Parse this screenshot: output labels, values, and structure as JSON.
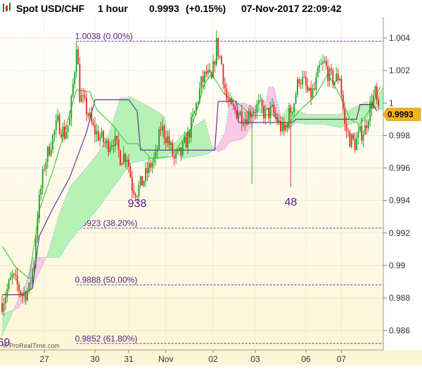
{
  "header": {
    "instrument": "Spot USD/CHF",
    "timeframe": "1 hour",
    "price": "0.9993",
    "change": "(+0.15%)",
    "datetime": "07-Nov-2017 22:09:42",
    "icon": "chart-logo-icon"
  },
  "watermark": "© ProRealTime.com",
  "colors": {
    "background_top": "#ffffff",
    "background_bottom": "#fcf6d6",
    "up_candle": "#1e9e1e",
    "down_candle": "#e8221a",
    "kumo_bull_fill": "#b6f2b6",
    "kumo_bear_fill": "#fbc8e8",
    "kijun": "#6a1a9a",
    "tenkan": "#33cc33",
    "fib_line": "#5a1a8a",
    "price_tag": "#f6b21a"
  },
  "chart_data": {
    "type": "candlestick",
    "title": "Spot USD/CHF",
    "timeframe": "1 hour",
    "x_tick_labels": [
      "27",
      "30",
      "31",
      "Nov",
      "02",
      "03",
      "06",
      "07"
    ],
    "y_tick_labels": [
      "1.004",
      "1.002",
      "1",
      "0.998",
      "0.996",
      "0.994",
      "0.992",
      "0.99",
      "0.988",
      "0.986"
    ],
    "ylim": [
      0.9848,
      1.0053
    ],
    "current_price": "0.9993",
    "fib_levels": [
      {
        "price": 1.0038,
        "label": "1.0038 (0.00%)"
      },
      {
        "price": 0.9923,
        "label": "0.9923 (38.20%)"
      },
      {
        "price": 0.9888,
        "label": "0.9888 (50.00%)"
      },
      {
        "price": 0.9852,
        "label": "0.9852 (61.80%)"
      }
    ],
    "annotations": [
      {
        "text": "69",
        "bar": 1,
        "price": 0.9853
      },
      {
        "text": "938",
        "bar": 80,
        "price": 0.99385
      },
      {
        "text": "48",
        "bar": 171,
        "price": 0.99395
      }
    ],
    "price_path": [
      [
        0,
        0.9877
      ],
      [
        6,
        0.9893
      ],
      [
        12,
        0.9882
      ],
      [
        16,
        0.9885
      ],
      [
        19,
        0.9904
      ],
      [
        21,
        0.9932
      ],
      [
        25,
        0.9962
      ],
      [
        29,
        0.9976
      ],
      [
        33,
        0.9988
      ],
      [
        37,
        0.9981
      ],
      [
        40,
        0.9989
      ],
      [
        43,
        1.0022
      ],
      [
        44,
        1.0038
      ],
      [
        46,
        1.0005
      ],
      [
        50,
        0.9996
      ],
      [
        54,
        0.9984
      ],
      [
        58,
        0.9979
      ],
      [
        62,
        0.9974
      ],
      [
        66,
        0.9978
      ],
      [
        70,
        0.9967
      ],
      [
        74,
        0.9968
      ],
      [
        77,
        0.9949
      ],
      [
        80,
        0.9946
      ],
      [
        84,
        0.9953
      ],
      [
        88,
        0.9962
      ],
      [
        91,
        0.9966
      ],
      [
        94,
        0.9985
      ],
      [
        98,
        0.9978
      ],
      [
        102,
        0.9965
      ],
      [
        106,
        0.9969
      ],
      [
        110,
        0.9979
      ],
      [
        114,
        0.9994
      ],
      [
        118,
        1.0012
      ],
      [
        121,
        1.0018
      ],
      [
        124,
        1.0013
      ],
      [
        127,
        1.0036
      ],
      [
        130,
        1.0024
      ],
      [
        133,
        1.0002
      ],
      [
        136,
        0.9996
      ],
      [
        140,
        0.9994
      ],
      [
        144,
        0.9991
      ],
      [
        148,
        0.9996
      ],
      [
        152,
        0.9998
      ],
      [
        156,
        0.9993
      ],
      [
        160,
        0.9995
      ],
      [
        164,
        0.9987
      ],
      [
        167,
        0.9982
      ],
      [
        170,
        0.9993
      ],
      [
        173,
        1.0001
      ],
      [
        176,
        1.0016
      ],
      [
        179,
        1.0012
      ],
      [
        182,
        1.0004
      ],
      [
        185,
        1.0008
      ],
      [
        188,
        1.0021
      ],
      [
        191,
        1.0024
      ],
      [
        194,
        1.0016
      ],
      [
        197,
        1.0014
      ],
      [
        200,
        1.0017
      ],
      [
        203,
        0.9986
      ],
      [
        206,
        0.9978
      ],
      [
        209,
        0.9975
      ],
      [
        212,
        0.9981
      ],
      [
        215,
        0.9984
      ],
      [
        218,
        0.9998
      ],
      [
        221,
        1.0006
      ],
      [
        223,
        0.9993
      ]
    ],
    "spikes": [
      {
        "bar": 44,
        "high": 1.0038
      },
      {
        "bar": 80,
        "low": 0.99385
      },
      {
        "bar": 148,
        "low": 0.99503
      },
      {
        "bar": 171,
        "low": 0.99482
      }
    ],
    "kijun": [
      [
        0,
        0.9882
      ],
      [
        12,
        0.9882
      ],
      [
        18,
        0.9886
      ],
      [
        22,
        0.9918
      ],
      [
        30,
        0.9935
      ],
      [
        40,
        0.9954
      ],
      [
        50,
        0.9982
      ],
      [
        55,
        1.0002
      ],
      [
        75,
        1.0002
      ],
      [
        80,
        0.9995
      ],
      [
        82,
        0.9971
      ],
      [
        126,
        0.9971
      ],
      [
        128,
        1.0001
      ],
      [
        139,
        1.0001
      ],
      [
        140,
        0.9988
      ],
      [
        172,
        0.9988
      ],
      [
        174,
        0.999
      ],
      [
        210,
        0.999
      ],
      [
        212,
        0.9999
      ],
      [
        220,
        0.9999
      ],
      [
        222,
        0.9995
      ]
    ],
    "tenkan": [
      [
        0,
        0.9912
      ],
      [
        8,
        0.9899
      ],
      [
        16,
        0.9892
      ],
      [
        22,
        0.9934
      ],
      [
        30,
        0.9958
      ],
      [
        38,
        0.9986
      ],
      [
        44,
        1.0008
      ],
      [
        52,
        1.0007
      ],
      [
        56,
        0.9996
      ],
      [
        66,
        0.9986
      ],
      [
        74,
        0.9975
      ],
      [
        80,
        0.9975
      ],
      [
        88,
        0.9966
      ],
      [
        100,
        0.9967
      ],
      [
        112,
        0.9984
      ],
      [
        120,
        1.0012
      ],
      [
        124,
        1.0018
      ],
      [
        132,
        1.0005
      ],
      [
        136,
        1.0002
      ],
      [
        142,
        0.9998
      ],
      [
        148,
        0.9992
      ],
      [
        160,
        0.9993
      ],
      [
        168,
        0.9985
      ],
      [
        176,
        0.9995
      ],
      [
        186,
        1.0005
      ],
      [
        193,
        1.0018
      ],
      [
        200,
        1.0005
      ],
      [
        206,
        0.999
      ],
      [
        212,
        0.9987
      ],
      [
        218,
        0.9996
      ],
      [
        224,
        1.001
      ]
    ],
    "kumo": {
      "span_a": [
        [
          0,
          0.987
        ],
        [
          10,
          0.9874
        ],
        [
          14,
          0.9884
        ],
        [
          18,
          0.9887
        ],
        [
          27,
          0.9907
        ],
        [
          34,
          0.9932
        ],
        [
          40,
          0.9948
        ],
        [
          56,
          0.9968
        ],
        [
          63,
          0.998
        ],
        [
          70,
          1.0003
        ],
        [
          76,
          1.0004
        ],
        [
          90,
          0.9996
        ],
        [
          96,
          0.9992
        ],
        [
          100,
          0.9974
        ],
        [
          104,
          0.9977
        ],
        [
          106,
          0.998
        ],
        [
          120,
          0.999
        ],
        [
          124,
          0.9974
        ],
        [
          128,
          0.997
        ],
        [
          132,
          0.9972
        ],
        [
          135,
          0.9976
        ],
        [
          143,
          0.9978
        ],
        [
          148,
          0.9986
        ],
        [
          152,
          0.9996
        ],
        [
          155,
          0.9998
        ],
        [
          158,
          0.9998
        ],
        [
          161,
          0.9991
        ],
        [
          165,
          0.999
        ],
        [
          170,
          0.9999
        ],
        [
          174,
          0.9996
        ],
        [
          180,
          0.9993
        ],
        [
          190,
          0.9993
        ],
        [
          200,
          0.9993
        ],
        [
          210,
          0.9998
        ],
        [
          216,
          1.0001
        ],
        [
          218,
          0.9998
        ],
        [
          226,
          1.001
        ]
      ],
      "span_b": [
        [
          0,
          0.9857
        ],
        [
          10,
          0.988
        ],
        [
          14,
          0.9888
        ],
        [
          18,
          0.9905
        ],
        [
          27,
          0.9905
        ],
        [
          34,
          0.9905
        ],
        [
          40,
          0.9915
        ],
        [
          56,
          0.9934
        ],
        [
          63,
          0.9944
        ],
        [
          70,
          0.9954
        ],
        [
          76,
          0.9963
        ],
        [
          90,
          0.9966
        ],
        [
          96,
          0.9966
        ],
        [
          100,
          0.9969
        ],
        [
          104,
          0.9969
        ],
        [
          106,
          0.9966
        ],
        [
          120,
          0.9968
        ],
        [
          124,
          0.997
        ],
        [
          128,
          0.9974
        ],
        [
          132,
          0.9982
        ],
        [
          135,
          1.0
        ],
        [
          143,
          1.0
        ],
        [
          148,
          0.9998
        ],
        [
          152,
          0.9994
        ],
        [
          155,
          0.9994
        ],
        [
          158,
          1.001
        ],
        [
          161,
          1.001
        ],
        [
          165,
          0.9992
        ],
        [
          170,
          0.9984
        ],
        [
          174,
          0.9988
        ],
        [
          180,
          0.9987
        ],
        [
          190,
          0.9987
        ],
        [
          200,
          0.9985
        ],
        [
          210,
          0.9988
        ],
        [
          216,
          0.9989
        ],
        [
          218,
          0.9997
        ],
        [
          226,
          0.9996
        ]
      ]
    }
  }
}
